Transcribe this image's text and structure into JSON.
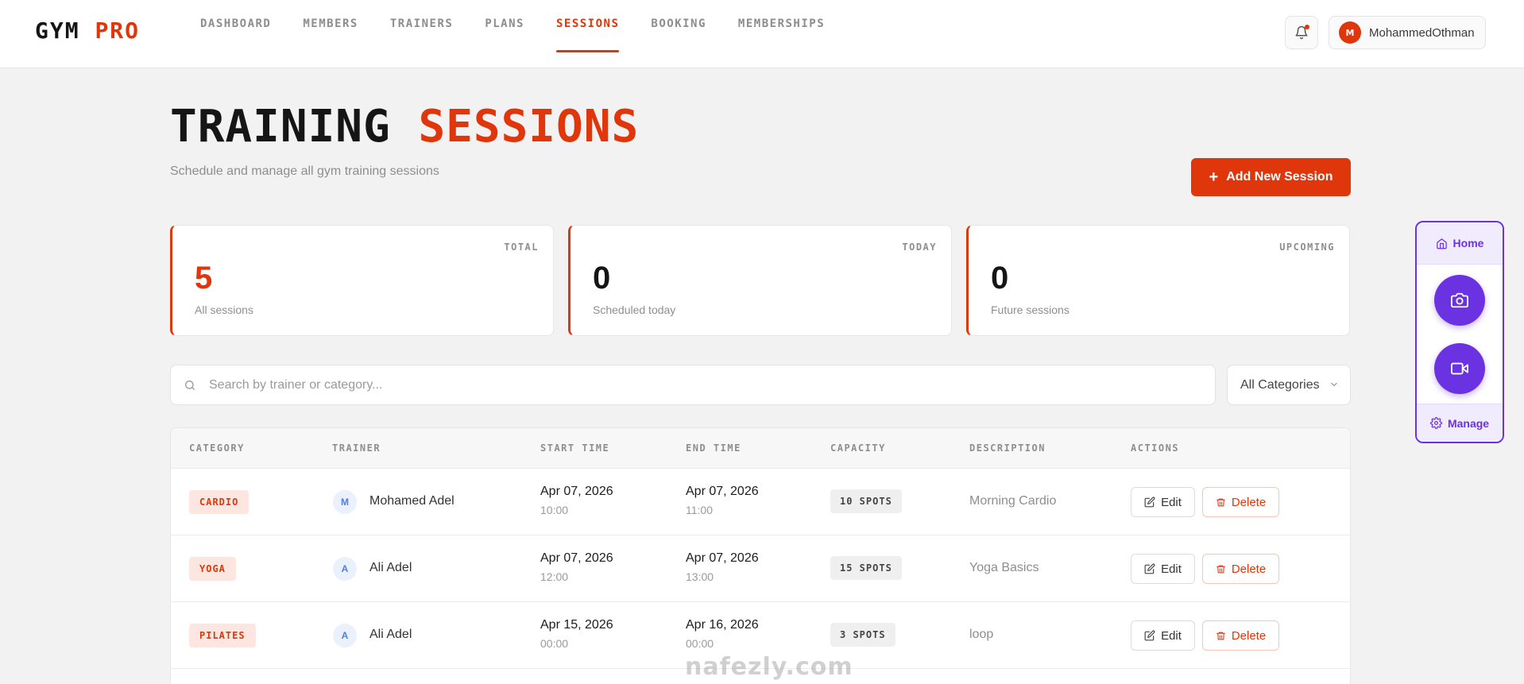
{
  "brand": {
    "name_part1": "GYM",
    "name_part2": "PRO",
    "accent_color": "#e0360b"
  },
  "nav": {
    "items": [
      {
        "label": "DASHBOARD",
        "active": false
      },
      {
        "label": "MEMBERS",
        "active": false
      },
      {
        "label": "TRAINERS",
        "active": false
      },
      {
        "label": "PLANS",
        "active": false
      },
      {
        "label": "SESSIONS",
        "active": true
      },
      {
        "label": "BOOKING",
        "active": false
      },
      {
        "label": "MEMBERSHIPS",
        "active": false
      }
    ]
  },
  "header": {
    "notification_icon": "bell-icon",
    "user": {
      "initial": "M",
      "name": "MohammedOthman"
    }
  },
  "page": {
    "title_part1": "TRAINING",
    "title_part2": "SESSIONS",
    "subtitle": "Schedule and manage all gym training sessions",
    "add_button_label": "Add New Session"
  },
  "stats": [
    {
      "tag": "TOTAL",
      "value": "5",
      "caption": "All sessions"
    },
    {
      "tag": "TODAY",
      "value": "0",
      "caption": "Scheduled today"
    },
    {
      "tag": "UPCOMING",
      "value": "0",
      "caption": "Future sessions"
    }
  ],
  "filters": {
    "search_placeholder": "Search by trainer or category...",
    "category_selected": "All Categories"
  },
  "table": {
    "columns": [
      "CATEGORY",
      "TRAINER",
      "START TIME",
      "END TIME",
      "CAPACITY",
      "DESCRIPTION",
      "ACTIONS"
    ],
    "rows": [
      {
        "category": "CARDIO",
        "trainer_initial": "M",
        "trainer": "Mohamed Adel",
        "start_date": "Apr 07, 2026",
        "start_time": "10:00",
        "end_date": "Apr 07, 2026",
        "end_time": "11:00",
        "capacity": "10 SPOTS",
        "description": "Morning Cardio"
      },
      {
        "category": "YOGA",
        "trainer_initial": "A",
        "trainer": "Ali Adel",
        "start_date": "Apr 07, 2026",
        "start_time": "12:00",
        "end_date": "Apr 07, 2026",
        "end_time": "13:00",
        "capacity": "15 SPOTS",
        "description": "Yoga Basics"
      },
      {
        "category": "PILATES",
        "trainer_initial": "A",
        "trainer": "Ali Adel",
        "start_date": "Apr 15, 2026",
        "start_time": "00:00",
        "end_date": "Apr 16, 2026",
        "end_time": "00:00",
        "capacity": "3 SPOTS",
        "description": "loop"
      }
    ],
    "edit_label": "Edit",
    "delete_label": "Delete"
  },
  "widget": {
    "home_label": "Home",
    "manage_label": "Manage",
    "camera_icon": "camera-icon",
    "video_icon": "video-icon",
    "color": "#6a32e0"
  },
  "watermark": "nafezly.com"
}
